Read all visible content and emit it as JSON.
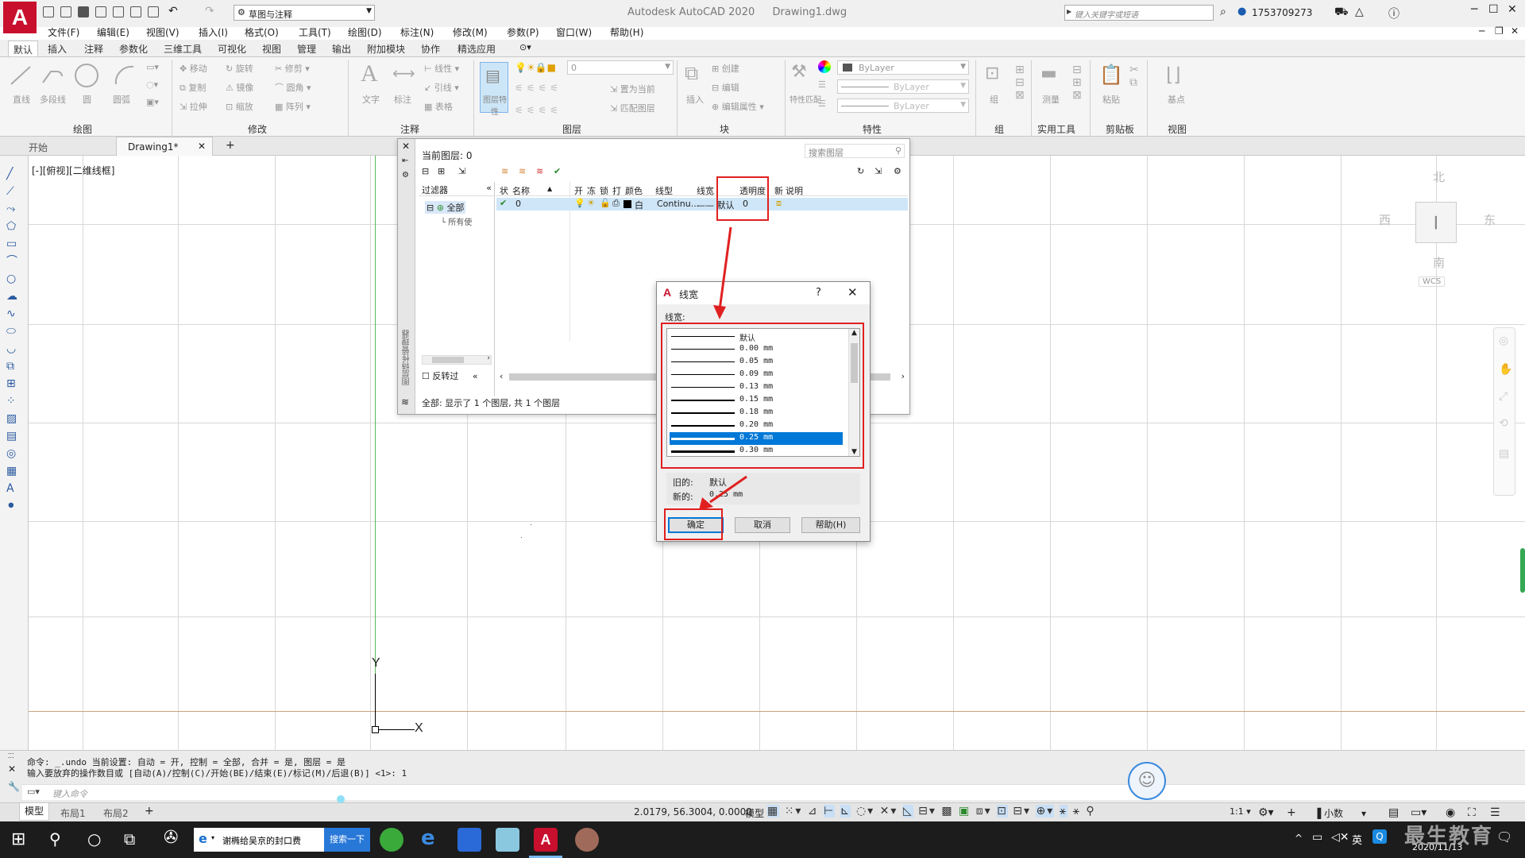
{
  "app": {
    "title": "Autodesk AutoCAD 2020",
    "document": "Drawing1.dwg",
    "logo_letter": "A",
    "workspace": "草图与注释",
    "search_placeholder": "键入关键字或短语",
    "user": "1753709273"
  },
  "menu": [
    "文件(F)",
    "编辑(E)",
    "视图(V)",
    "插入(I)",
    "格式(O)",
    "工具(T)",
    "绘图(D)",
    "标注(N)",
    "修改(M)",
    "参数(P)",
    "窗口(W)",
    "帮助(H)"
  ],
  "ribbon_tabs": [
    "默认",
    "插入",
    "注释",
    "参数化",
    "三维工具",
    "可视化",
    "视图",
    "管理",
    "输出",
    "附加模块",
    "协作",
    "精选应用"
  ],
  "ribbon": {
    "draw_tools": [
      "直线",
      "多段线",
      "圆",
      "圆弧"
    ],
    "modify_tools": [
      "移动",
      "旋转",
      "修剪",
      "复制",
      "镜像",
      "圆角",
      "拉伸",
      "缩放",
      "阵列"
    ],
    "annotation_tools": [
      "文字",
      "标注",
      "线性",
      "引线",
      "表格"
    ],
    "layer_tools": [
      "图层特性",
      "置为当前",
      "匹配图层"
    ],
    "layer_current": "0",
    "block_tools": [
      "插入",
      "创建",
      "编辑",
      "编辑属性"
    ],
    "properties": {
      "match": "特性匹配",
      "color": "ByLayer",
      "linetype": "ByLayer",
      "lineweight": "ByLayer"
    },
    "group_tools": [
      "组"
    ],
    "utility_tools": [
      "测量"
    ],
    "clipboard_tools": [
      "粘贴"
    ],
    "view_tools": [
      "基点"
    ],
    "panel_labels": [
      "绘图",
      "修改",
      "注释",
      "图层",
      "块",
      "特性",
      "组",
      "实用工具",
      "剪贴板",
      "视图"
    ]
  },
  "doc_tabs": [
    "开始",
    "Drawing1*"
  ],
  "viewport_label": "[-][俯视][二维线框]",
  "viewcube": {
    "north": "北",
    "south": "南",
    "east": "东",
    "west": "西",
    "wcs": "WCS"
  },
  "ucs": {
    "x": "X",
    "y": "Y"
  },
  "layer_manager": {
    "current_layer": "当前图层: 0",
    "search_placeholder": "搜索图层",
    "filter_header": "过滤器",
    "tree_all": "全部",
    "tree_used": "所有使",
    "invert_filter": "反转过",
    "columns": [
      "状",
      "名称",
      "开",
      "冻",
      "锁",
      "打",
      "颜色",
      "线型",
      "线宽",
      "透明度",
      "新",
      "说明"
    ],
    "row": {
      "name": "0",
      "color": "白",
      "linetype": "Continu...",
      "lineweight": "—— 默认",
      "transparency": "0"
    },
    "status": "全部: 显示了 1 个图层, 共 1 个图层",
    "side_label": "图层特性管理器"
  },
  "lineweight_dialog": {
    "title": "线宽",
    "help_glyph": "?",
    "label": "线宽:",
    "items": [
      "默认",
      "0.00 mm",
      "0.05 mm",
      "0.09 mm",
      "0.13 mm",
      "0.15 mm",
      "0.18 mm",
      "0.20 mm",
      "0.25 mm",
      "0.30 mm"
    ],
    "selected_index": 8,
    "old_label": "旧的:",
    "old_value": "默认",
    "new_label": "新的:",
    "new_value": "0.25 mm",
    "ok": "确定",
    "cancel": "取消",
    "help": "帮助(H)"
  },
  "command": {
    "line1": "命令: _.undo 当前设置: 自动 = 开, 控制 = 全部, 合并 = 是, 图层 = 是",
    "line2": "输入要放弃的操作数目或 [自动(A)/控制(C)/开始(BE)/结束(E)/标记(M)/后退(B)] <1>: 1",
    "placeholder": "键入命令"
  },
  "layout_tabs": [
    "模型",
    "布局1",
    "布局2"
  ],
  "status": {
    "coords": "2.0179, 56.3004, 0.0000",
    "model": "模型",
    "scale": "1:1",
    "units": "小数"
  },
  "taskbar": {
    "ie_tab": "谢椭给吴京的封口费",
    "search_btn": "搜索一下",
    "ime": "英",
    "date": "2020/11/13",
    "watermark": "最生教育"
  }
}
